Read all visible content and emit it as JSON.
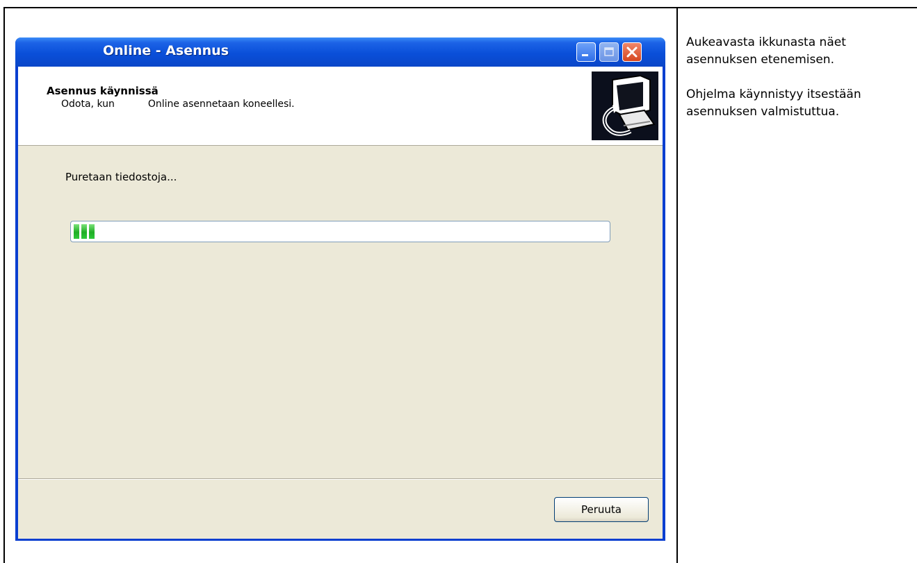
{
  "window": {
    "title": "Online - Asennus",
    "header_title": "Asennus käynnissä",
    "header_sub_1": "Odota, kun",
    "header_sub_2": "Online asennetaan koneellesi.",
    "status_text": "Puretaan tiedostoja...",
    "progress_fraction": 0.05,
    "cancel_label": "Peruuta"
  },
  "side_panel": {
    "paragraph_1": "Aukeavasta ikkunasta näet asennuksen etenemisen.",
    "paragraph_2": "Ohjelma käynnistyy itsestään asennuksen valmistuttua."
  },
  "icons": [
    "minimize-icon",
    "maximize-icon",
    "close-icon",
    "installer-computer-icon"
  ],
  "colors": {
    "titlebar": "#0a4fd9",
    "client_bg": "#ece9d8",
    "progress_fill": "#2ec93a",
    "close_button": "#d6461f"
  }
}
